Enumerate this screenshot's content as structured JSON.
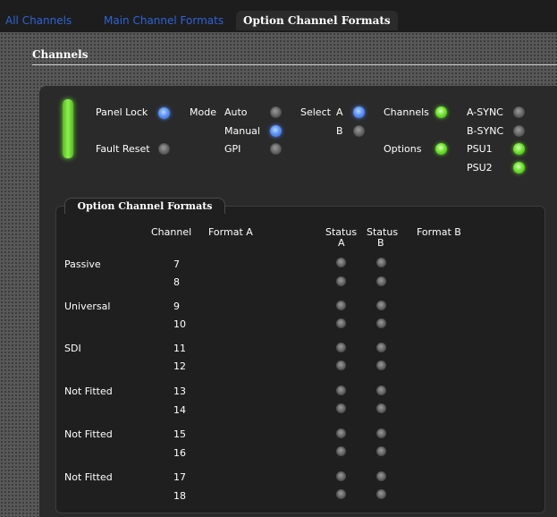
{
  "tabs": [
    {
      "label": "All Channels",
      "active": false
    },
    {
      "label": "Main Channel Formats",
      "active": false
    },
    {
      "label": "Option Channel Formats",
      "active": true
    }
  ],
  "section_title": "Channels",
  "controls": {
    "panel_lock": {
      "label": "Panel Lock",
      "state": "blue"
    },
    "fault_reset": {
      "label": "Fault Reset",
      "state": "off"
    },
    "mode": {
      "label": "Mode",
      "options": [
        {
          "label": "Auto",
          "state": "off"
        },
        {
          "label": "Manual",
          "state": "blue"
        },
        {
          "label": "GPI",
          "state": "off"
        }
      ]
    },
    "select": {
      "label": "Select",
      "options": [
        {
          "label": "A",
          "state": "blue"
        },
        {
          "label": "B",
          "state": "off"
        }
      ]
    },
    "channels": {
      "label": "Channels",
      "state": "green"
    },
    "options": {
      "label": "Options",
      "state": "green"
    },
    "status": [
      {
        "label": "A-SYNC",
        "state": "off"
      },
      {
        "label": "B-SYNC",
        "state": "off"
      },
      {
        "label": "PSU1",
        "state": "green"
      },
      {
        "label": "PSU2",
        "state": "green"
      }
    ]
  },
  "ocf": {
    "title": "Option Channel Formats",
    "headers": {
      "channel": "Channel",
      "format_a": "Format A",
      "status_a_1": "Status",
      "status_a_2": "A",
      "status_b_1": "Status",
      "status_b_2": "B",
      "format_b": "Format B"
    },
    "groups": [
      {
        "name": "Passive",
        "channels": [
          "7",
          "8"
        ]
      },
      {
        "name": "Universal",
        "channels": [
          "9",
          "10"
        ]
      },
      {
        "name": "SDI",
        "channels": [
          "11",
          "12"
        ]
      },
      {
        "name": "Not Fitted",
        "channels": [
          "13",
          "14"
        ]
      },
      {
        "name": "Not Fitted",
        "channels": [
          "15",
          "16"
        ]
      },
      {
        "name": "Not Fitted",
        "channels": [
          "17",
          "18"
        ]
      }
    ]
  }
}
